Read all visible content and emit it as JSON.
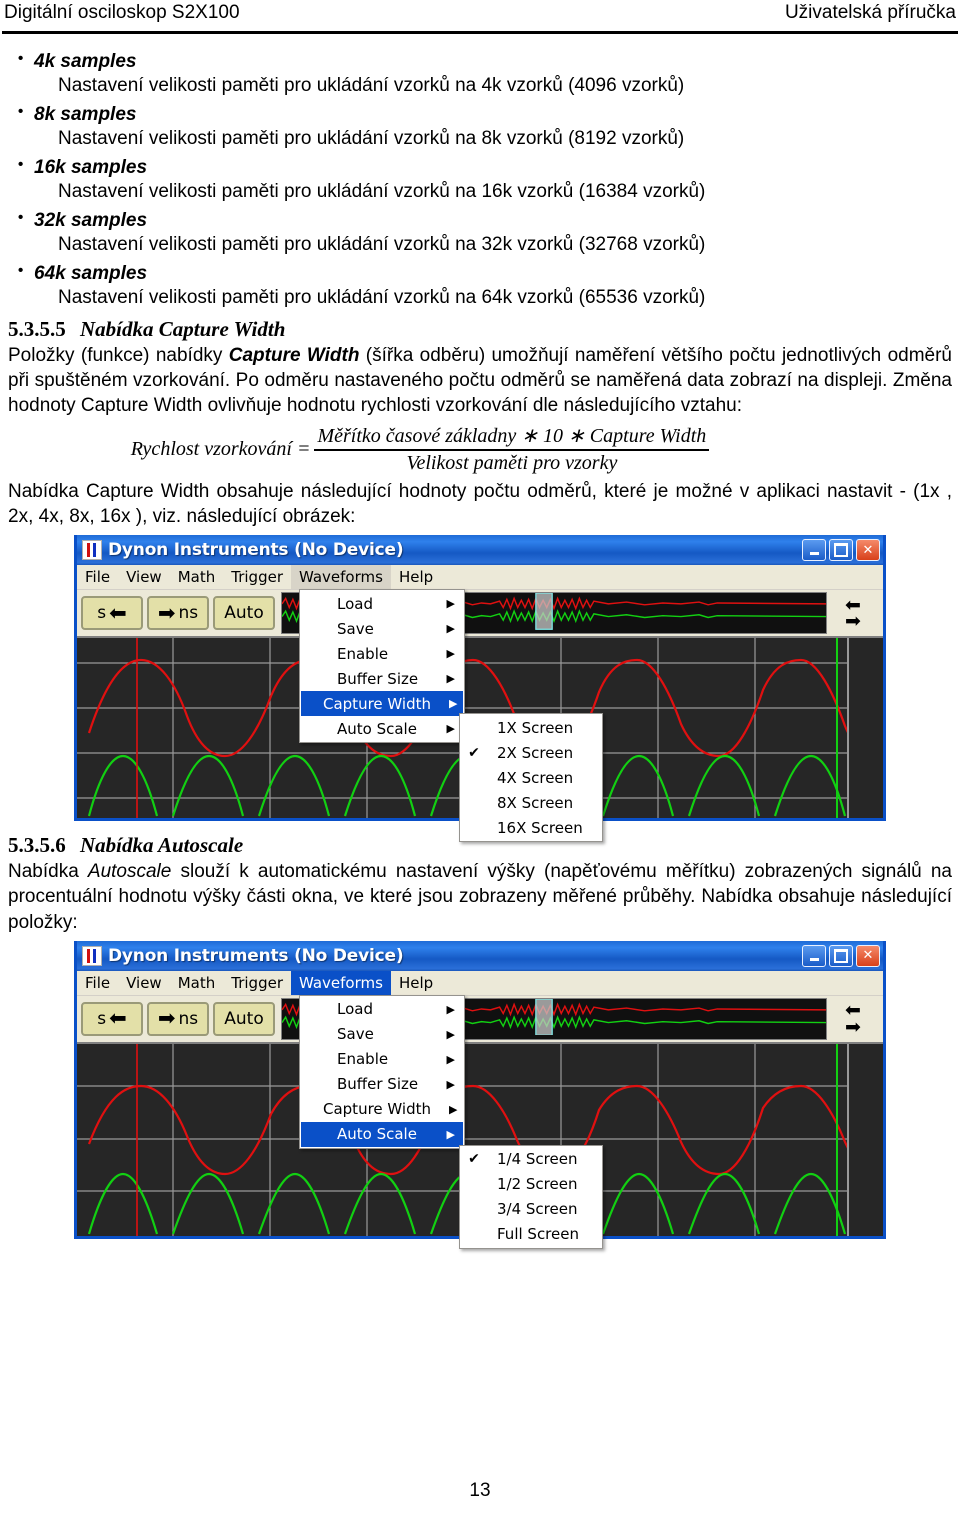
{
  "header": {
    "left": "Digitální osciloskop S2X100",
    "right": "Uživatelská příručka"
  },
  "bullets": [
    {
      "term": "4k samples",
      "desc": "Nastavení velikosti paměti pro ukládání vzorků na 4k vzorků (4096 vzorků)"
    },
    {
      "term": "8k samples",
      "desc": "Nastavení velikosti paměti pro ukládání vzorků na 8k vzorků (8192 vzorků)"
    },
    {
      "term": "16k samples",
      "desc": "Nastavení velikosti paměti pro ukládání vzorků na 16k vzorků (16384 vzorků)"
    },
    {
      "term": "32k samples",
      "desc": "Nastavení velikosti paměti pro ukládání vzorků na 32k vzorků (32768 vzorků)"
    },
    {
      "term": "64k samples",
      "desc": "Nastavení velikosti paměti pro ukládání vzorků na 64k vzorků (65536 vzorků)"
    }
  ],
  "section_capture_width": {
    "number": "5.3.5.5",
    "title": "Nabídka Capture Width",
    "para_1_a": "Položky (funkce) nabídky ",
    "para_1_em": "Capture Width",
    "para_1_b": " (šířka odběru) umožňují naměření většího počtu jednotlivých odměrů při spuštěném vzorkování. Po odměru nastaveného počtu odměrů se naměřená data zobrazí na displeji. Změna hodnoty Capture Width ovlivňuje hodnotu rychlosti vzorkování dle následujícího vztahu:",
    "formula": {
      "lhs": "Rychlost vzorkování =",
      "numerator": "Měřítko časové základny ∗ 10 ∗ Capture Width",
      "denominator": "Velikost paměti pro vzorky"
    },
    "para_2": "Nabídka Capture Width obsahuje následující hodnoty počtu odměrů, které je možné v aplikaci nastavit - (1x , 2x, 4x, 8x, 16x ), viz. následující obrázek:"
  },
  "section_autoscale": {
    "number": "5.3.5.6",
    "title": "Nabídka Autoscale",
    "para_a": "Nabídka ",
    "para_em": "Autoscale",
    "para_b": " slouží k automatickému nastavení výšky (napěťovému měřítku) zobrazených signálů na procentuální hodnotu výšky části okna, ve které jsou zobrazeny měřené průběhy. Nabídka obsahuje následující položky:"
  },
  "app_window": {
    "title": "Dynon Instruments (No Device)",
    "window_buttons": {
      "minimize": "_",
      "maximize": "□",
      "close": "✕"
    },
    "menubar": [
      "File",
      "View",
      "Math",
      "Trigger",
      "Waveforms",
      "Help"
    ],
    "active_menu": "Waveforms",
    "toolbar_buttons": [
      {
        "label": "s",
        "icon": "arrow-left-icon",
        "order": "label-first"
      },
      {
        "label": "ns",
        "icon": "arrow-right-icon",
        "order": "icon-first"
      },
      {
        "label": "Auto",
        "icon": "",
        "order": "label-only"
      }
    ],
    "nav_buttons": {
      "left": "⬅",
      "right": "➡"
    },
    "waveforms_menu": [
      "Load",
      "Save",
      "Enable",
      "Buffer Size",
      "Capture Width",
      "Auto Scale"
    ]
  },
  "screenshot_capture_width": {
    "highlighted_item": "Capture Width",
    "submenu": {
      "items": [
        "1X Screen",
        "2X Screen",
        "4X Screen",
        "8X Screen",
        "16X Screen"
      ],
      "checked": "2X Screen",
      "check_glyph": "✔"
    }
  },
  "screenshot_autoscale": {
    "highlighted_item": "Auto Scale",
    "submenu": {
      "items": [
        "1/4 Screen",
        "1/2 Screen",
        "3/4 Screen",
        "Full Screen"
      ],
      "checked": "1/4 Screen",
      "check_glyph": "✔"
    }
  },
  "colors": {
    "titlebar_blue": "#1559c4",
    "menu_highlight": "#0a50c8",
    "trace_red": "#e01010",
    "trace_green": "#12d012",
    "scope_background": "#262626",
    "toolbar_button": "#e3e0a8",
    "window_chrome": "#ece9d8"
  },
  "footer": {
    "page_number": "13"
  }
}
